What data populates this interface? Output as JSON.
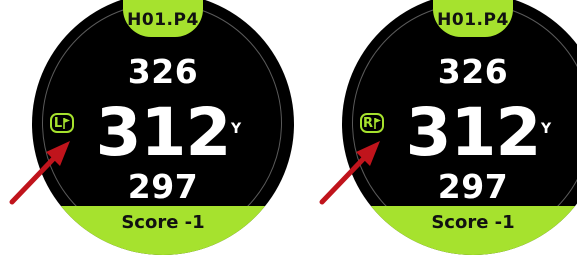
{
  "accent_color": "#a6e22e",
  "pointer_color": "#c0141c",
  "watches": [
    {
      "hole": "H01.P4",
      "back_distance": "326",
      "middle_distance": "312",
      "front_distance": "297",
      "unit": "Y",
      "pin_side": "L",
      "pin_icon": "flag-icon",
      "score": "Score -1"
    },
    {
      "hole": "H01.P4",
      "back_distance": "326",
      "middle_distance": "312",
      "front_distance": "297",
      "unit": "Y",
      "pin_side": "R",
      "pin_icon": "flag-icon",
      "score": "Score -1"
    }
  ]
}
